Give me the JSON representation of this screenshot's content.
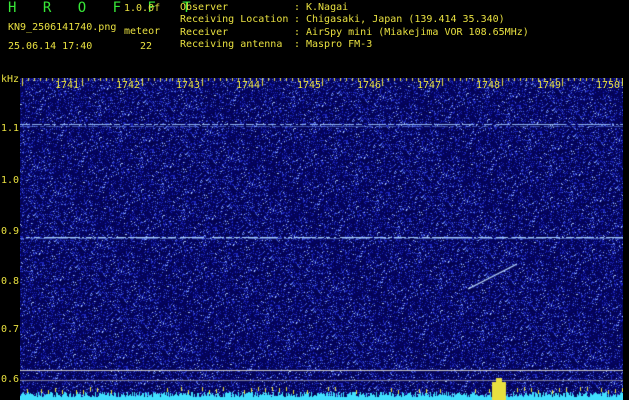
{
  "header": {
    "app_title": "H R O F F T",
    "version": "1.0.0f",
    "filename": "KN9_2506141740.png",
    "meteor_label": "meteor",
    "datetime": "25.06.14 17:40",
    "meteor_count": "22"
  },
  "info": [
    {
      "key": "Observer",
      "value": "K.Nagai"
    },
    {
      "key": "Receiving Location",
      "value": "Chigasaki, Japan (139.414 35.340)"
    },
    {
      "key": "Receiver",
      "value": "AirSpy mini (Miakejima VOR 108.65MHz)"
    },
    {
      "key": "Receiving antenna",
      "value": "Maspro FM-3"
    }
  ],
  "axes": {
    "y_unit": "kHz",
    "y_ticks": [
      "1.1",
      "1.0",
      "0.9",
      "0.8",
      "0.7",
      "0.6"
    ],
    "x_ticks": [
      "1741",
      "1742",
      "1743",
      "1744",
      "1745",
      "1746",
      "1747",
      "1748",
      "1749",
      "1750"
    ]
  },
  "colors": {
    "background": "#000000",
    "spectrogram": "#0a0a5a",
    "label_yellow": "#e8e040",
    "title_green": "#38e838",
    "band_cyan": "#40e0ff"
  }
}
